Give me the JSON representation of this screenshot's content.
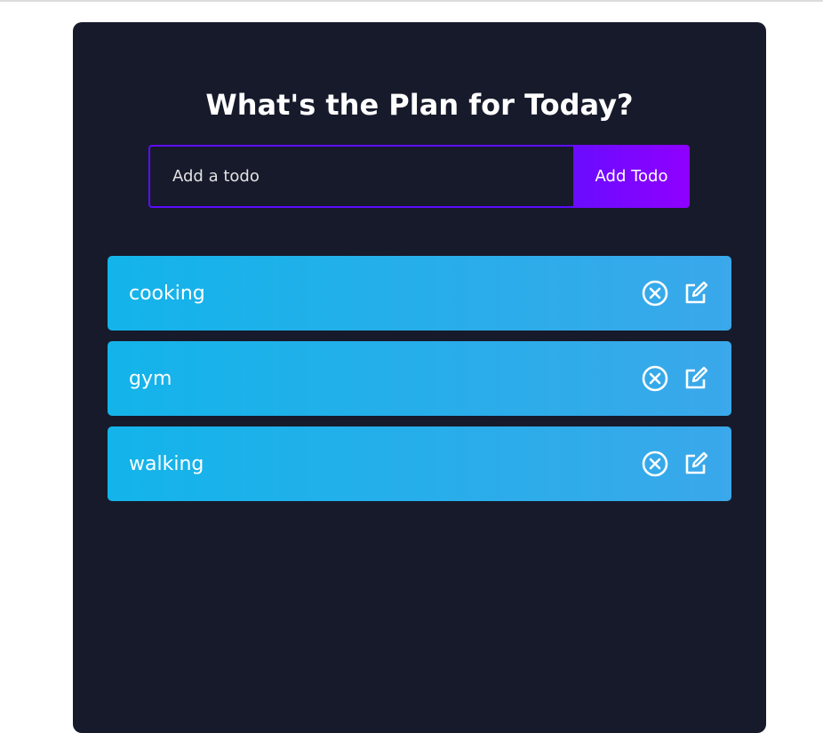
{
  "app": {
    "title": "What's the Plan for Today?"
  },
  "form": {
    "input_placeholder": "Add a todo",
    "input_value": "",
    "button_label": "Add Todo"
  },
  "todos": [
    {
      "text": "cooking",
      "icons": [
        "close-circle-icon",
        "edit-icon"
      ]
    },
    {
      "text": "gym",
      "icons": [
        "close-circle-icon",
        "edit-icon"
      ]
    },
    {
      "text": "walking",
      "icons": [
        "close-circle-icon",
        "edit-icon"
      ]
    }
  ],
  "colors": {
    "page_background": "#ffffff",
    "card_background": "#161a2b",
    "input_border": "#5d0cff",
    "button_gradient_start": "#6a0cff",
    "button_gradient_end": "#8f00ff",
    "row_gradient_start": "#13b4ea",
    "row_gradient_end": "#3aa8ea",
    "text": "#ffffff"
  }
}
